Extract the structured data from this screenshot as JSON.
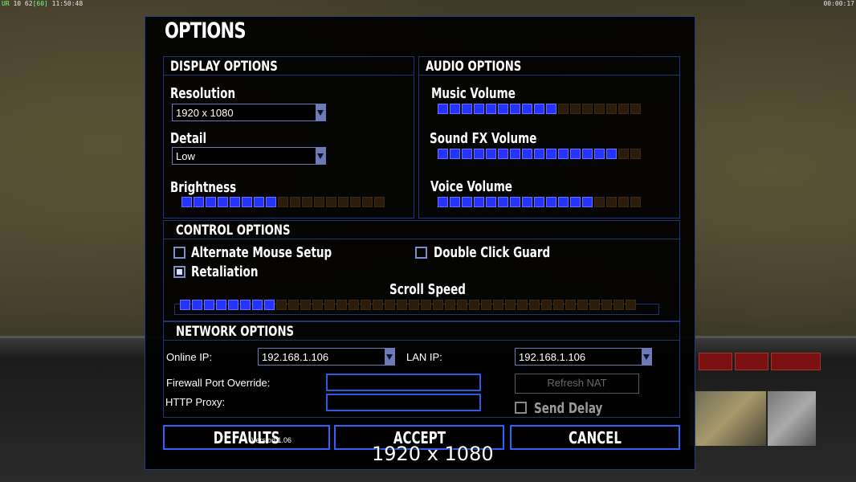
{
  "hud": {
    "ur": "UR",
    "counters": "10 62",
    "fps": "[60]",
    "clock": "11:50:48",
    "timer": "00:00:17"
  },
  "dialog": {
    "title": "OPTIONS"
  },
  "display_options": {
    "header": "DISPLAY OPTIONS",
    "resolution_label": "Resolution",
    "resolution_value": "1920 x 1080",
    "detail_label": "Detail",
    "detail_value": "Low",
    "brightness_label": "Brightness",
    "brightness_level": 8,
    "brightness_total": 17
  },
  "audio_options": {
    "header": "AUDIO OPTIONS",
    "music_label": "Music Volume",
    "music_level": 10,
    "music_total": 17,
    "sfx_label": "Sound FX Volume",
    "sfx_level": 15,
    "sfx_total": 17,
    "voice_label": "Voice Volume",
    "voice_level": 13,
    "voice_total": 17
  },
  "control_options": {
    "header": "CONTROL OPTIONS",
    "alt_mouse_label": "Alternate Mouse Setup",
    "alt_mouse_checked": false,
    "double_click_label": "Double Click Guard",
    "double_click_checked": false,
    "retaliation_label": "Retaliation",
    "retaliation_checked": true,
    "scroll_label": "Scroll Speed",
    "scroll_level": 8,
    "scroll_total": 38
  },
  "network_options": {
    "header": "NETWORK OPTIONS",
    "online_ip_label": "Online IP:",
    "online_ip_value": "192.168.1.106",
    "lan_ip_label": "LAN IP:",
    "lan_ip_value": "192.168.1.106",
    "firewall_label": "Firewall Port Override:",
    "firewall_value": "",
    "http_proxy_label": "HTTP Proxy:",
    "http_proxy_value": "",
    "refresh_nat_label": "Refresh NAT",
    "send_delay_label": "Send Delay",
    "send_delay_checked": false
  },
  "buttons": {
    "defaults": "DEFAULTS",
    "accept": "ACCEPT",
    "cancel": "CANCEL"
  },
  "version": "Version 1.06",
  "overlay_resolution": "1920 x 1080"
}
